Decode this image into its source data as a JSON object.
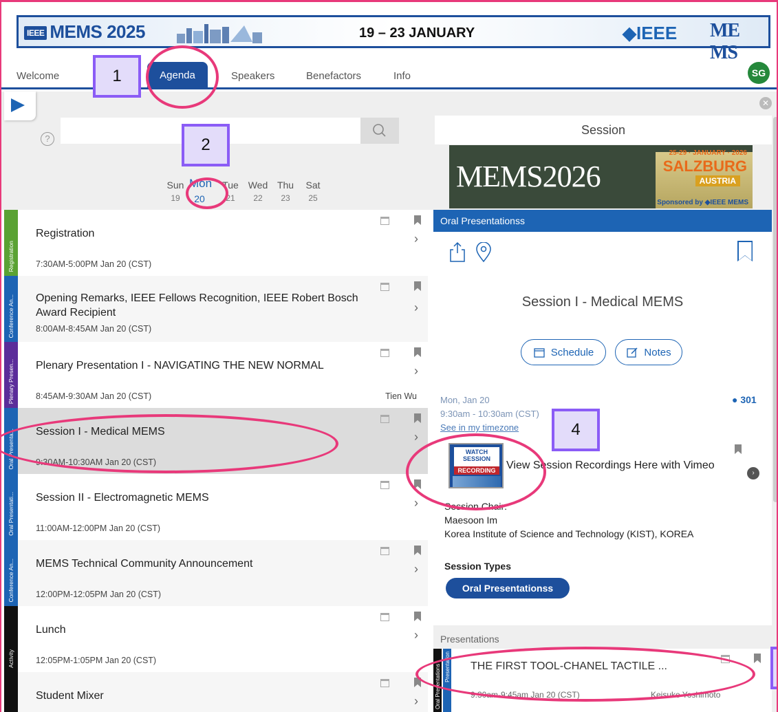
{
  "banner": {
    "logo_badge": "IEEE",
    "logo_text": "MEMS 2025",
    "dates": "19 – 23 JANUARY",
    "ieee_text": "◆IEEE",
    "mems_text": "ME MS"
  },
  "nav": {
    "items": [
      "Welcome",
      "Agenda",
      "Speakers",
      "Benefactors",
      "Info"
    ],
    "avatar_initials": "SG"
  },
  "search": {
    "help": "?",
    "placeholder": ""
  },
  "days": [
    {
      "name": "Sun",
      "date": "19"
    },
    {
      "name": "Mon",
      "date": "20",
      "selected": true
    },
    {
      "name": "Tue",
      "date": "21"
    },
    {
      "name": "Wed",
      "date": "22"
    },
    {
      "name": "Thu",
      "date": "23"
    },
    {
      "name": "Sat",
      "date": "25"
    }
  ],
  "sessions": [
    {
      "category": "Registration",
      "cat_color": "#5aa233",
      "title": "Registration",
      "time": "7:30AM-5:00PM Jan 20 (CST)",
      "speaker": ""
    },
    {
      "category": "Conference An...",
      "cat_color": "#1d64b4",
      "title": "Opening Remarks, IEEE Fellows Recognition, IEEE Robert Bosch Award Recipient",
      "time": "8:00AM-8:45AM Jan 20 (CST)",
      "speaker": ""
    },
    {
      "category": "Plenary Presen...",
      "cat_color": "#5b2d9a",
      "title": "Plenary Presentation I - NAVIGATING THE NEW NORMAL",
      "time": "8:45AM-9:30AM Jan 20 (CST)",
      "speaker": "Tien Wu"
    },
    {
      "category": "Oral Presenta...",
      "cat_color": "#1d64b4",
      "title": "Session I - Medical MEMS",
      "time": "9:30AM-10:30AM Jan 20 (CST)",
      "speaker": "",
      "selected": true
    },
    {
      "category": "Oral Presentati...",
      "cat_color": "#1d64b4",
      "title": "Session II - Electromagnetic MEMS",
      "time": "11:00AM-12:00PM Jan 20 (CST)",
      "speaker": ""
    },
    {
      "category": "Conference An...",
      "cat_color": "#1d64b4",
      "title": "MEMS Technical Community Announcement",
      "time": "12:00PM-12:05PM Jan 20 (CST)",
      "speaker": ""
    },
    {
      "category": "Activity",
      "cat_color": "#111111",
      "title": "Lunch",
      "time": "12:05PM-1:05PM Jan 20 (CST)",
      "speaker": ""
    },
    {
      "category": "Activity",
      "cat_color": "#111111",
      "title": "Student Mixer",
      "time": "",
      "speaker": ""
    }
  ],
  "detail": {
    "header": "Session",
    "promo": {
      "title": "MEMS2026",
      "dates": "25-29 · JANUARY · 2026",
      "city": "SALZBURG",
      "country": "AUSTRIA",
      "sponsor": "Sponsored by ◆IEEE MEMS"
    },
    "type_bar": "Oral Presentationss",
    "title": "Session I - Medical MEMS",
    "schedule_label": "Schedule",
    "notes_label": "Notes",
    "date": "Mon, Jan 20",
    "time": "9:30am - 10:30am  (CST)",
    "timezone_link": "See in my timezone",
    "room": "301",
    "recording": {
      "badge_top": "WATCH SESSION",
      "badge_mid": "RECORDING",
      "label": "View Session Recordings Here with Vimeo"
    },
    "chair_label": "Session Chair:",
    "chair_name": "Maesoon Im",
    "chair_affil": "Korea Institute of Science and Technology (KIST), KOREA",
    "session_types_label": "Session Types",
    "session_type": "Oral Presentationss",
    "presentations_label": "Presentations",
    "presentation": {
      "cat1": "Oral Presentations",
      "cat2": "Presentation",
      "title": "THE FIRST TOOL-CHANEL TACTILE ...",
      "time": "9:30am-9:45am Jan 20 (CST)",
      "speaker": "Keisuke Yoshimoto"
    }
  },
  "annotations": [
    "1",
    "2",
    "4"
  ]
}
